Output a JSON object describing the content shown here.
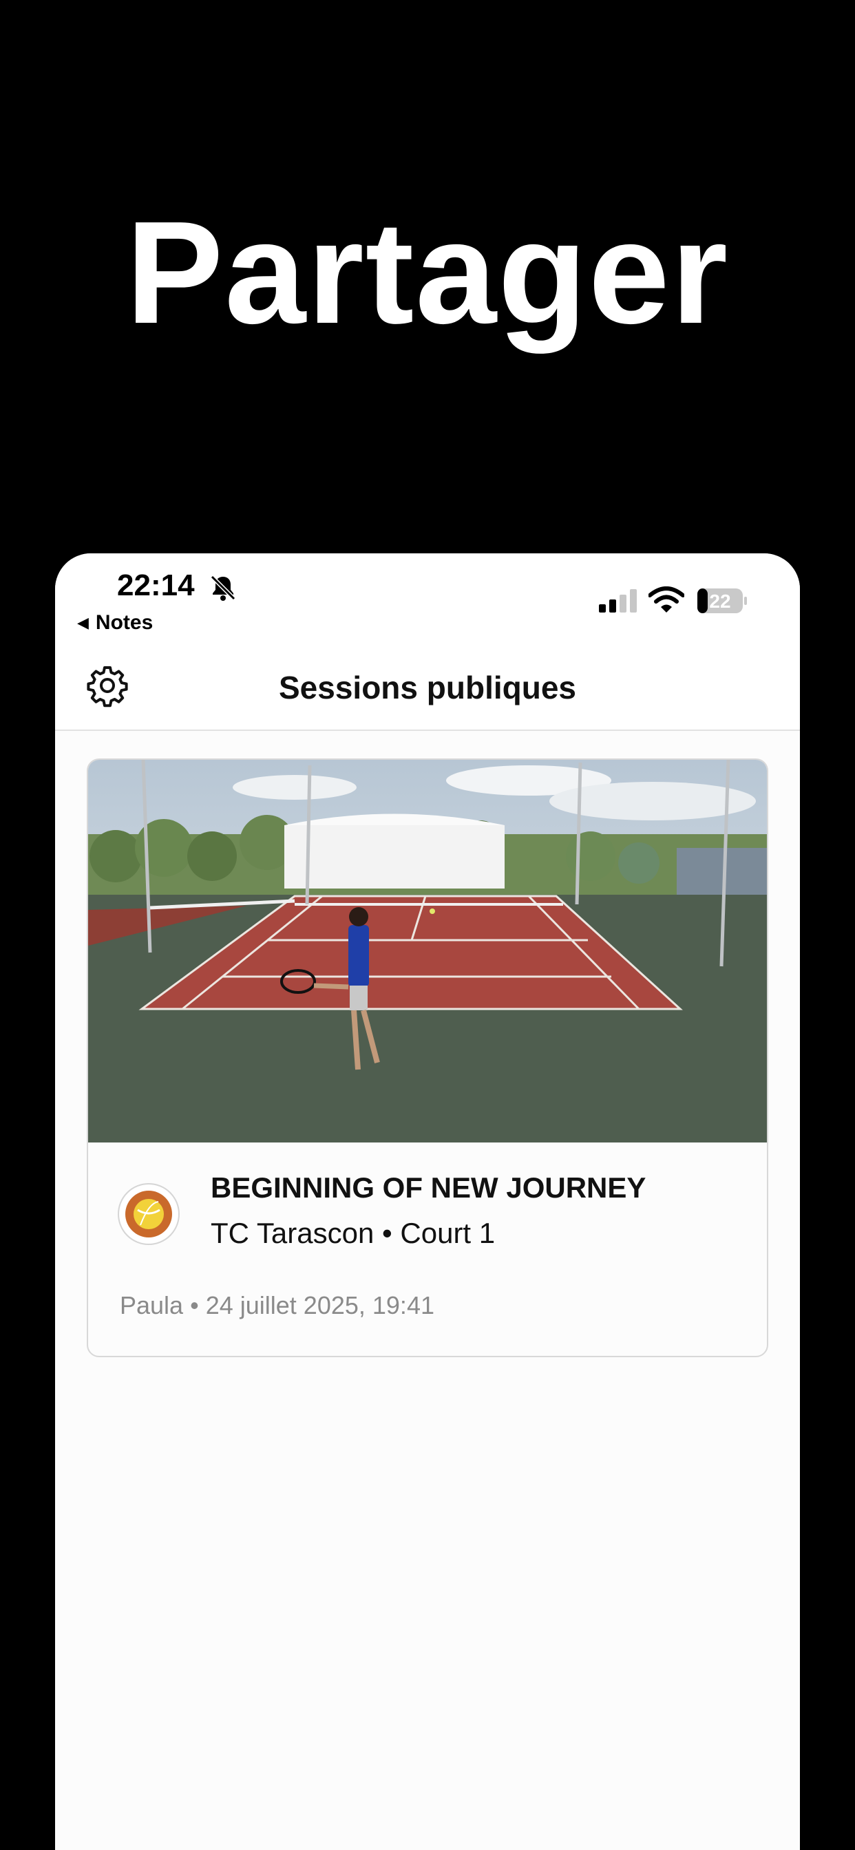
{
  "hero": {
    "title": "Partager"
  },
  "status_bar": {
    "time": "22:14",
    "back_label": "Notes",
    "battery_level": "22",
    "icons": [
      "bell-slash-icon",
      "signal-icon",
      "wifi-icon",
      "battery-icon"
    ]
  },
  "nav": {
    "title": "Sessions publiques",
    "settings_icon": "gear-icon"
  },
  "sessions": [
    {
      "title": "BEGINNING OF NEW JOURNEY",
      "club": "TC Tarascon",
      "separator": "•",
      "court": "Court 1",
      "author": "Paula",
      "date": "24 juillet 2025, 19:41",
      "thumbnail": "tennis-court-photo",
      "logo": "club-logo-icon"
    }
  ],
  "colors": {
    "background": "#000000",
    "screen": "#fcfcfc",
    "text": "#111111",
    "muted_text": "#8a8a8a",
    "clay": "#a8473f",
    "court_green": "#4f5e4f"
  }
}
